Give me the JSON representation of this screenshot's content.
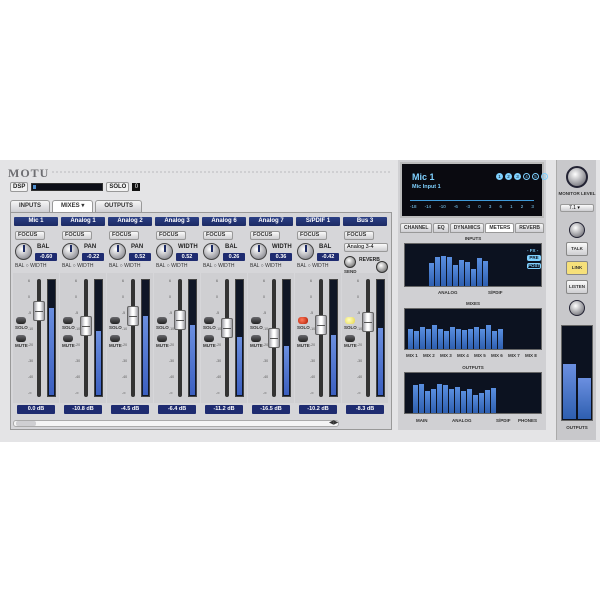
{
  "app": {
    "logo": "MOTU"
  },
  "top": {
    "dsp_label": "DSP",
    "dsp_load": 0.04,
    "solo_label": "SOLO",
    "solo_indicator": "0"
  },
  "tabs": [
    {
      "label": "INPUTS"
    },
    {
      "label": "MIXES",
      "dropdown": "▾"
    },
    {
      "label": "OUTPUTS"
    }
  ],
  "accent": "#1e2b70",
  "channels": [
    {
      "name": "Mic 1",
      "knob_label": "BAL",
      "knob_value": "-0.60",
      "radio_a": "BAL",
      "radio_b": "WIDTH",
      "db": "0.0 dB",
      "fader": 0.78,
      "meter": 0.75,
      "solo_state": "off"
    },
    {
      "name": "Analog 1",
      "knob_label": "PAN",
      "knob_value": "-0.22",
      "radio_a": "BAL",
      "radio_b": "WIDTH",
      "db": "-10.8 dB",
      "fader": 0.62,
      "meter": 0.55,
      "solo_state": "off"
    },
    {
      "name": "Analog 2",
      "knob_label": "PAN",
      "knob_value": "0.52",
      "radio_a": "BAL",
      "radio_b": "WIDTH",
      "db": "-4.5 dB",
      "fader": 0.72,
      "meter": 0.68,
      "solo_state": "off"
    },
    {
      "name": "Analog 3",
      "knob_label": "WIDTH",
      "knob_value": "0.52",
      "radio_a": "BAL",
      "radio_b": "WIDTH",
      "db": "-6.4 dB",
      "fader": 0.68,
      "meter": 0.6,
      "solo_state": "off"
    },
    {
      "name": "Analog 6",
      "knob_label": "BAL",
      "knob_value": "0.26",
      "radio_a": "BAL",
      "radio_b": "WIDTH",
      "db": "-11.2 dB",
      "fader": 0.6,
      "meter": 0.5,
      "solo_state": "off"
    },
    {
      "name": "Analog 7",
      "knob_label": "WIDTH",
      "knob_value": "0.36",
      "radio_a": "BAL",
      "radio_b": "WIDTH",
      "db": "-16.5 dB",
      "fader": 0.5,
      "meter": 0.42,
      "solo_state": "off"
    },
    {
      "name": "S/PDIF 1",
      "knob_label": "BAL",
      "knob_value": "-0.42",
      "radio_a": "BAL",
      "radio_b": "WIDTH",
      "db": "-10.2 dB",
      "fader": 0.63,
      "meter": 0.52,
      "solo_state": "red"
    },
    {
      "name": "Bus 3",
      "knob_label": "",
      "knob_value": "",
      "radio_a": "",
      "radio_b": "",
      "db": "-8.3 dB",
      "fader": 0.66,
      "meter": 0.58,
      "solo_state": "yellow",
      "source": "Analog 3-4",
      "reverb_label": "REVERB",
      "send_label": "SEND",
      "rtn_label": "RTN"
    }
  ],
  "focus_label": "FOCUS",
  "solo_label": "SOLO",
  "mute_label": "MUTE",
  "scale_marks": [
    "6",
    "0",
    "-5",
    "-10",
    "-20",
    "-30",
    "-40",
    "-∞"
  ],
  "right": {
    "lcd_title": "Mic 1",
    "lcd_sub": "Mic Input 1",
    "lcd_buttons": [
      "1",
      "2",
      "3",
      "4",
      "5",
      "6"
    ],
    "lcd_scale": [
      "-18",
      "-14",
      "-10",
      "-6",
      "-3",
      "0",
      "3",
      "6",
      "1",
      "2",
      "3"
    ],
    "tabs": [
      "CHANNEL",
      "EQ",
      "DYNAMICS",
      "METERS",
      "REVERB"
    ],
    "active_tab": "METERS",
    "inputs_title": "INPUTS",
    "inputs_labels": [
      "ANALOG",
      "S/PDIF"
    ],
    "fx_label": "- FX -",
    "fx_pre": "PRE",
    "fx_post": "POST",
    "mixes_title": "MIXES",
    "mixes_labels": [
      "MIX 1",
      "MIX 2",
      "MIX 3",
      "MIX 4",
      "MIX 5",
      "MIX 6",
      "MIX 7",
      "MIX 8"
    ],
    "outputs_title": "OUTPUTS",
    "outputs_labels": [
      "MAIN",
      "ANALOG",
      "S/PDIF",
      "PHONES"
    ],
    "input_levels": [
      0.55,
      0.7,
      0.72,
      0.68,
      0.5,
      0.62,
      0.58,
      0.4,
      0.66,
      0.6
    ],
    "mix_levels": [
      0.5,
      0.45,
      0.55,
      0.5,
      0.6,
      0.5,
      0.45,
      0.55,
      0.5,
      0.48,
      0.5,
      0.55,
      0.5,
      0.6,
      0.45,
      0.5
    ],
    "output_levels": [
      0.7,
      0.72,
      0.55,
      0.6,
      0.72,
      0.7,
      0.6,
      0.65,
      0.55,
      0.6,
      0.45,
      0.5,
      0.58,
      0.62
    ]
  },
  "side": {
    "monitor_label": "MONITOR LEVEL",
    "monitor_select": "7.1",
    "talk": "TALK",
    "link": "LINK",
    "listen": "LISTEN",
    "outputs_label": "OUTPUTS",
    "out_levels": [
      0.6,
      0.45
    ]
  }
}
